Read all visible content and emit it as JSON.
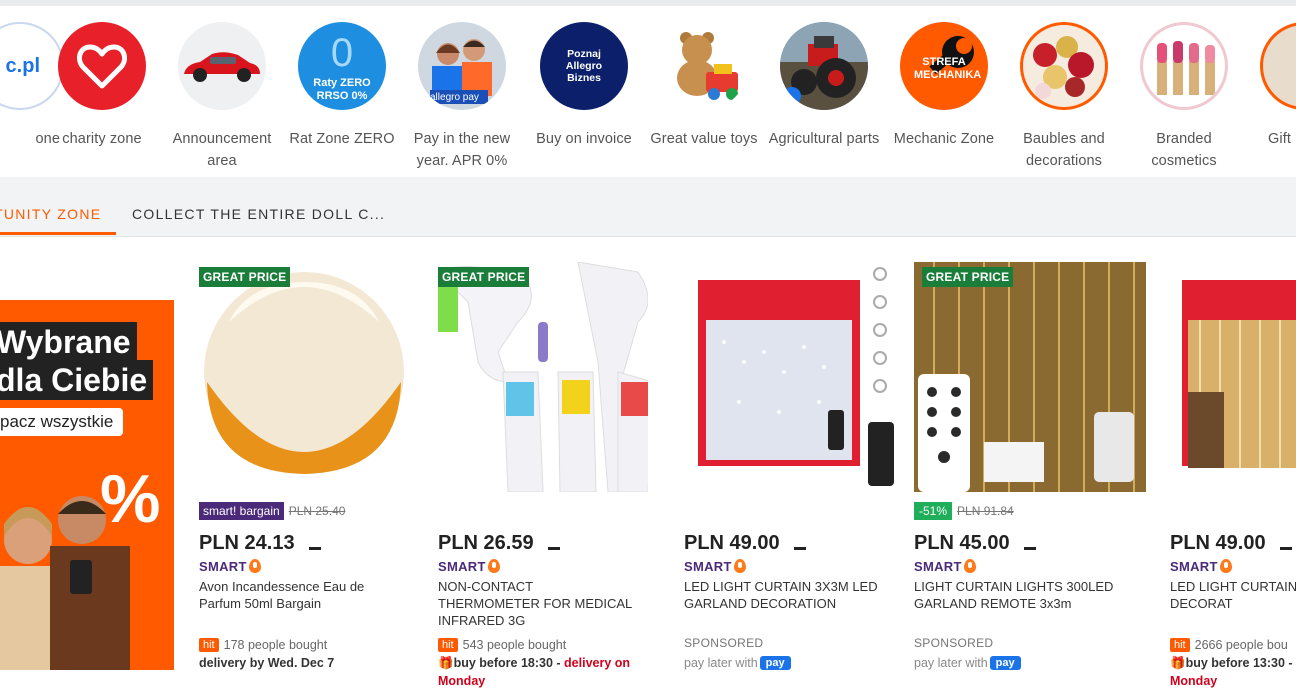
{
  "categories": [
    {
      "label": "one",
      "icon": "allegro-logo-icon",
      "circle_text": "c.pl"
    },
    {
      "label": "charity zone",
      "icon": "heart-icon",
      "circle_text": ""
    },
    {
      "label": "Announcement area",
      "icon": "car-icon",
      "circle_text": ""
    },
    {
      "label": "Rat Zone ZERO",
      "icon": "zero-installment-icon",
      "circle_text": "Raty ZERO RRSO 0%"
    },
    {
      "label": "Pay in the new year. APR 0%",
      "icon": "allegro-pay-people-icon",
      "circle_text": "allegro pay"
    },
    {
      "label": "Buy on invoice",
      "icon": "allegro-biznes-icon",
      "circle_text": "Poznaj Allegro Biznes"
    },
    {
      "label": "Great value toys",
      "icon": "teddy-bear-icon",
      "circle_text": ""
    },
    {
      "label": "Agricultural parts",
      "icon": "tractor-icon",
      "circle_text": ""
    },
    {
      "label": "Mechanic Zone",
      "icon": "wrench-icon",
      "circle_text": "STREFA MECHANIKA"
    },
    {
      "label": "Baubles and decorations",
      "icon": "bauble-icon",
      "circle_text": ""
    },
    {
      "label": "Branded cosmetics",
      "icon": "lipstick-icon",
      "circle_text": ""
    },
    {
      "label": "Gift",
      "icon": "gift-icon",
      "circle_text": ""
    }
  ],
  "tabs": [
    {
      "label": "TUNITY ZONE",
      "active": true
    },
    {
      "label": "COLLECT THE ENTIRE DOLL C..."
    }
  ],
  "promo": {
    "line1": "Wybrane",
    "line2": "dla Ciebie",
    "cta": "pacz wszystkie",
    "percent": "%"
  },
  "products": [
    {
      "badge": "GREAT PRICE",
      "tag": "smart! bargain",
      "old_price": "PLN 25.40",
      "price": "PLN 24.13",
      "smart": "SMART",
      "title": "Avon Incandessence Eau de Parfum 50ml Bargain",
      "hit": "hit",
      "bought": "178 people bought",
      "delivery": "delivery by Wed. Dec 7",
      "image": "perfume-icon"
    },
    {
      "badge": "GREAT PRICE",
      "price": "PLN 26.59",
      "smart": "SMART",
      "title": "NON-CONTACT THERMOMETER FOR MEDICAL INFRARED 3G",
      "hit": "hit",
      "bought": "543 people bought",
      "delivery_prefix": "buy before 18:30 - ",
      "delivery_red": "delivery on Monday",
      "image": "thermometer-icon"
    },
    {
      "price": "PLN 49.00",
      "smart": "SMART",
      "title": "LED LIGHT CURTAIN 3X3M LED GARLAND DECORATION",
      "sponsored": "SPONSORED",
      "pay_later": "pay later with",
      "pay": "pay",
      "image": "led-curtain-icon"
    },
    {
      "badge": "GREAT PRICE",
      "discount": "-51%",
      "old_price": "PLN 91.84",
      "price": "PLN 45.00",
      "smart": "SMART",
      "title": "LIGHT CURTAIN LIGHTS 300LED GARLAND REMOTE 3x3m",
      "sponsored": "SPONSORED",
      "pay_later": "pay later with",
      "pay": "pay",
      "image": "light-curtain-icon"
    },
    {
      "price": "PLN 49.00",
      "smart": "SMART",
      "title": "LED LIGHT CURTAIN GARLAND DECORAT",
      "hit": "hit",
      "bought": "2666 people bou",
      "delivery_prefix": "buy before 13:30 - ",
      "delivery_red": "Monday",
      "image": "led-curtain-2-icon"
    }
  ],
  "colors": {
    "accent": "#ff5a00",
    "great_price": "#1b7d3a",
    "smart": "#4b2a7a",
    "pay": "#1a73e8",
    "discount": "#1fae5a"
  }
}
